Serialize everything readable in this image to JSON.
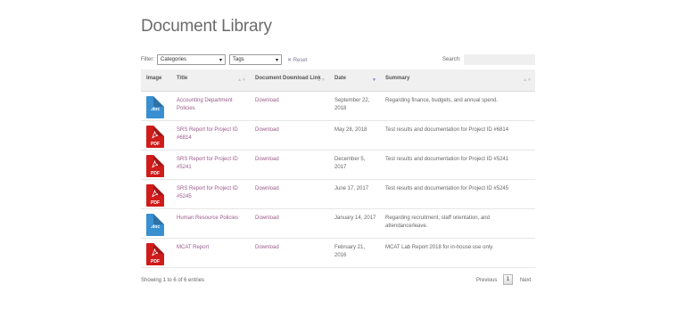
{
  "page": {
    "title": "Document Library"
  },
  "controls": {
    "filter_label": "Filter:",
    "categories_value": "Categories",
    "tags_value": "Tags",
    "reset_label": "Reset",
    "search_label": "Search:",
    "search_value": ""
  },
  "table": {
    "headers": {
      "image": "Image",
      "title": "Title",
      "download": "Document Download Link",
      "date": "Date",
      "summary": "Summary"
    },
    "rows": [
      {
        "type": "doc",
        "icon_label": ".doc",
        "title": "Accounting Department Policies",
        "download": "Download",
        "date": "September 22, 2018",
        "summary": "Regarding finance, budgets, and annual spend."
      },
      {
        "type": "pdf",
        "icon_label": "PDF",
        "title": "SRS Report for Project ID #6814",
        "download": "Download",
        "date": "May 28, 2018",
        "summary": "Test results and documentation for Project ID #6814"
      },
      {
        "type": "pdf",
        "icon_label": "PDF",
        "title": "SRS Report for Project ID #5241",
        "download": "Download",
        "date": "December 5, 2017",
        "summary": "Test results and documentation for Project ID #5241"
      },
      {
        "type": "pdf",
        "icon_label": "PDF",
        "title": "SRS Report for Project ID #5245",
        "download": "Download",
        "date": "June 17, 2017",
        "summary": "Test results and documentation for Project ID #5245"
      },
      {
        "type": "doc",
        "icon_label": ".doc",
        "title": "Human Resource Policies",
        "download": "Download",
        "date": "January 14, 2017",
        "summary": "Regarding recruitment, staff orientation, and attendance/leave."
      },
      {
        "type": "pdf",
        "icon_label": "PDF",
        "title": "MCAT Report",
        "download": "Download",
        "date": "February 21, 2016",
        "summary": "MCAT Lab Report 2018 for in-house use only."
      }
    ]
  },
  "footer": {
    "info": "Showing 1 to 6 of 6 entries",
    "previous": "Previous",
    "page": "1",
    "next": "Next"
  },
  "colors": {
    "doc_icon": "#3a8fd0",
    "pdf_icon": "#d01b1b",
    "link": "#9a5a8a",
    "header_bg": "#f0f0f0"
  }
}
